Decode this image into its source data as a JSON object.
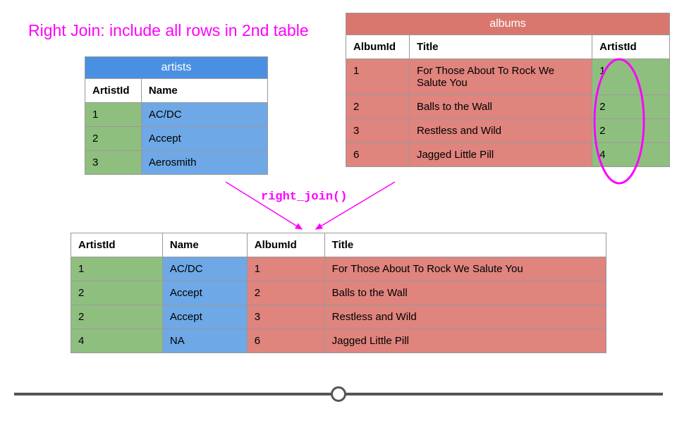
{
  "heading": {
    "strong": "Right Join:",
    "rest": " include all rows in 2nd table"
  },
  "function_label": "right_join()",
  "artists": {
    "title": "artists",
    "cols": [
      "ArtistId",
      "Name"
    ],
    "rows": [
      {
        "ArtistId": "1",
        "Name": "AC/DC"
      },
      {
        "ArtistId": "2",
        "Name": "Accept"
      },
      {
        "ArtistId": "3",
        "Name": "Aerosmith"
      }
    ]
  },
  "albums": {
    "title": "albums",
    "cols": [
      "AlbumId",
      "Title",
      "ArtistId"
    ],
    "rows": [
      {
        "AlbumId": "1",
        "Title": "For Those About To Rock We Salute You",
        "ArtistId": "1"
      },
      {
        "AlbumId": "2",
        "Title": "Balls to the Wall",
        "ArtistId": "2"
      },
      {
        "AlbumId": "3",
        "Title": "Restless and Wild",
        "ArtistId": "2"
      },
      {
        "AlbumId": "6",
        "Title": "Jagged Little Pill",
        "ArtistId": "4"
      }
    ]
  },
  "result": {
    "cols": [
      "ArtistId",
      "Name",
      "AlbumId",
      "Title"
    ],
    "rows": [
      {
        "ArtistId": "1",
        "Name": "AC/DC",
        "AlbumId": "1",
        "Title": "For Those About To Rock We Salute You"
      },
      {
        "ArtistId": "2",
        "Name": "Accept",
        "AlbumId": "2",
        "Title": "Balls to the Wall"
      },
      {
        "ArtistId": "2",
        "Name": "Accept",
        "AlbumId": "3",
        "Title": "Restless and Wild"
      },
      {
        "ArtistId": "4",
        "Name": "NA",
        "AlbumId": "6",
        "Title": "Jagged Little Pill"
      }
    ]
  },
  "chart_data": {
    "type": "table",
    "description": "Illustration of a SQL/dplyr right join between 'artists' (left) and 'albums' (right) on ArtistId, keeping all albums rows.",
    "left_table": "artists",
    "right_table": "albums",
    "join_key": "ArtistId",
    "operation": "right_join",
    "highlight": "albums.ArtistId column circled in magenta"
  }
}
